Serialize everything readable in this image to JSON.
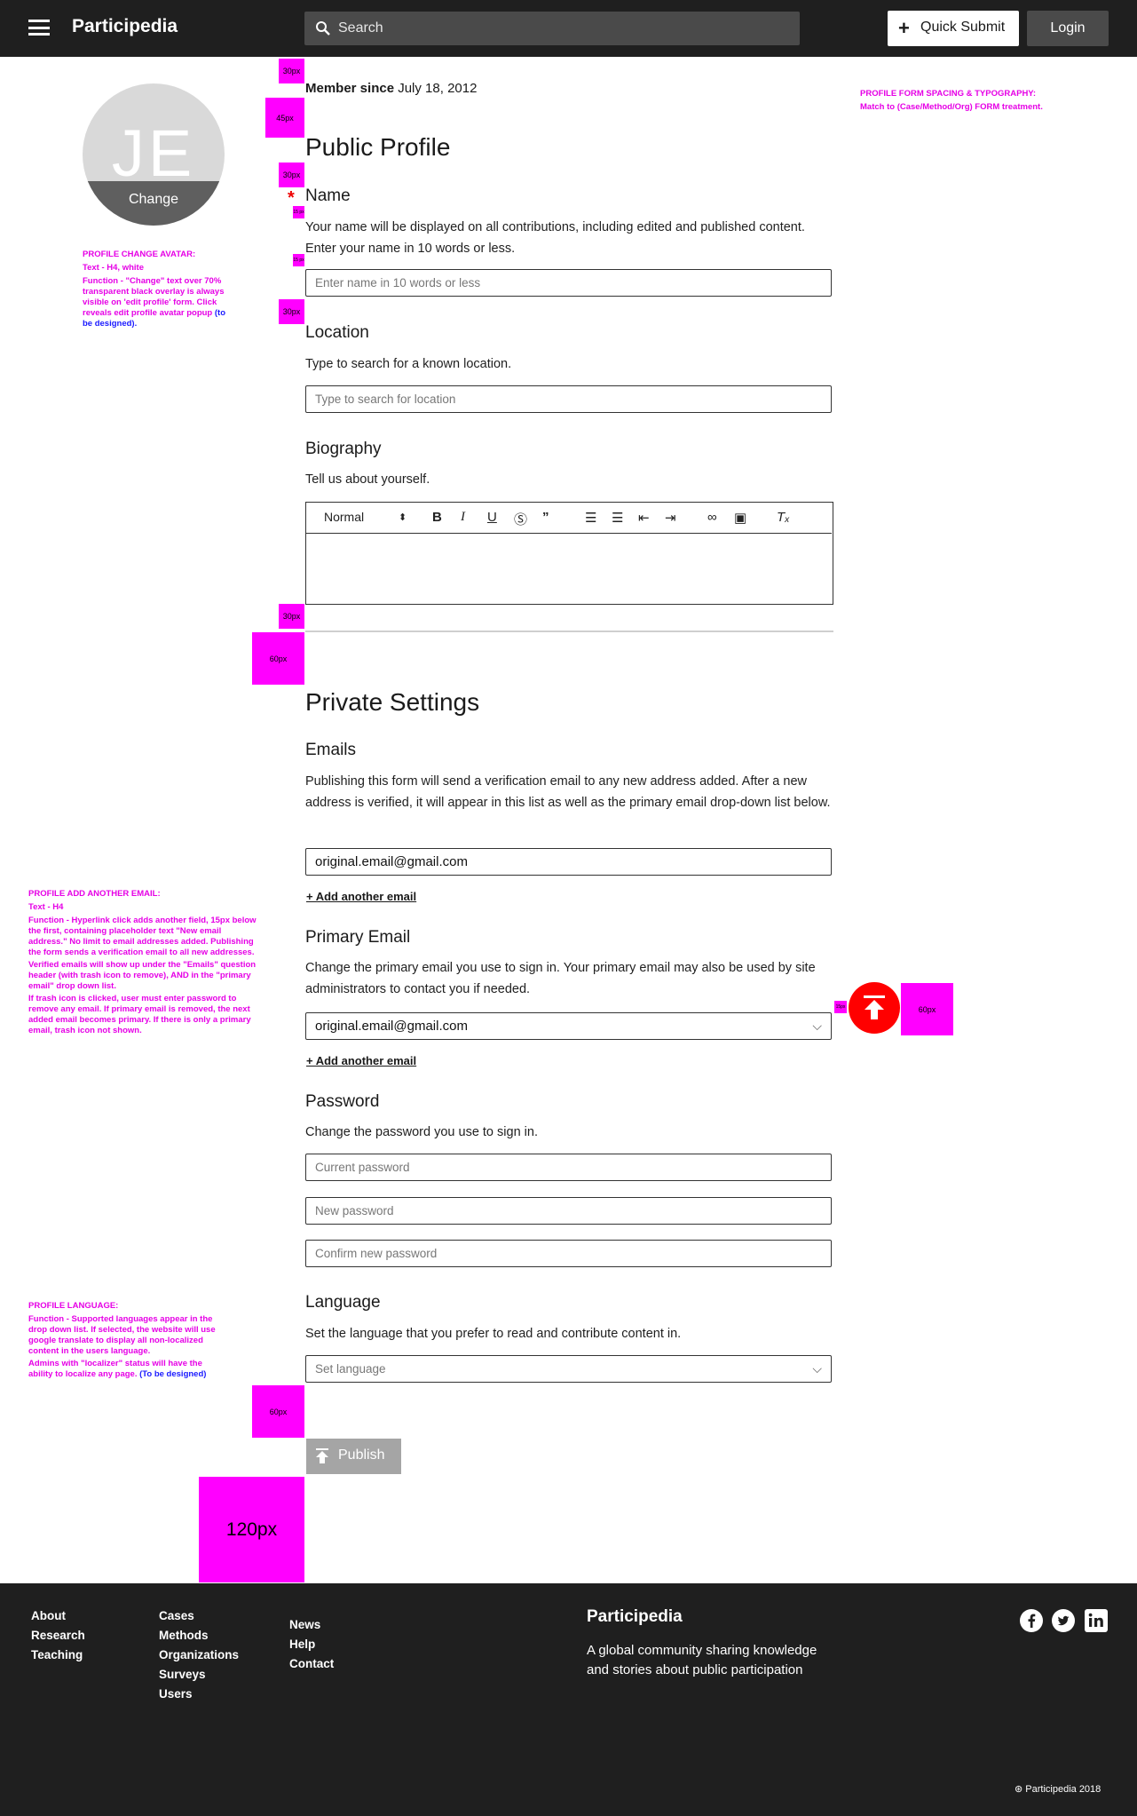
{
  "header": {
    "brand": "Participedia",
    "search_placeholder": "Search",
    "quick_submit_label": "Quick Submit",
    "login_label": "Login"
  },
  "avatar": {
    "initials": "JE",
    "change_label": "Change"
  },
  "annotations": {
    "avatar_note": {
      "title": "PROFILE CHANGE AVATAR:",
      "text": "Text - H4, white",
      "function": "Function - \"Change\" text over 70% transparent black overlay is always visible on 'edit profile' form. Click reveals edit profile avatar popup",
      "link": "(to be designed)."
    },
    "form_spacing_note": {
      "title": "PROFILE FORM SPACING & TYPOGRAPHY:",
      "text": "Match to (Case/Method/Org) FORM treatment."
    },
    "email_note": {
      "title": "PROFILE ADD ANOTHER EMAIL:",
      "text": "Text - H4",
      "function": "Function - Hyperlink click adds another field, 15px below the first, containing placeholder text \"New email address.\" No limit to email addresses added. Publishing the form sends a verification email to all new addresses.",
      "verified": "Verified emails will show up under the \"Emails\" question header (with trash icon to remove), AND in the \"primary email\" drop down list.",
      "trash": "If trash icon is clicked, user must enter password to remove any email. If primary email is removed, the next added email becomes primary. If there is only a primary email, trash icon not shown."
    },
    "language_note": {
      "title": "PROFILE LANGUAGE:",
      "function": "Function - Supported languages appear in the drop down list. If selected, the website will use google translate to display all non-localized content in the users language.",
      "admins": "Admins with \"localizer\" status will have the ability to localize any page.",
      "link": "(To be designed)"
    },
    "spacers": {
      "s30a": "30px",
      "s45": "45px",
      "s30b": "30px",
      "s30c": "30px",
      "s30d": "30px",
      "s60a": "60px",
      "s60b": "60px",
      "s60c": "60px",
      "s120": "120px",
      "s15a": "15 px",
      "s15b": "15 px",
      "s15c": "15px"
    }
  },
  "member": {
    "label": "Member since",
    "date": "July 18, 2012"
  },
  "public_profile": {
    "title": "Public Profile",
    "name_label": "Name",
    "required_mark": "*",
    "name_help_1": "Your name will be displayed on all contributions, including edited and published content.",
    "name_help_2": "Enter your name in 10 words or less.",
    "name_placeholder": "Enter name in 10 words or less",
    "location_label": "Location",
    "location_help": "Type to search for a known location.",
    "location_placeholder": "Type to search for location",
    "bio_label": "Biography",
    "bio_help": "Tell us about yourself.",
    "editor_style": "Normal"
  },
  "private_settings": {
    "title": "Private Settings",
    "emails_label": "Emails",
    "emails_help": "Publishing this form will send a verification email to any new address added. After a new address is verified, it will appear in this list as well as the primary email drop-down list below.",
    "email_value": "original.email@gmail.com",
    "add_email": "+ Add another email",
    "primary_label": "Primary Email",
    "primary_help": "Change the primary email you use to sign in. Your primary email may also be used by site administrators to contact you if needed.",
    "primary_value": "original.email@gmail.com",
    "add_email_2": "+ Add another email",
    "password_label": "Password",
    "password_help": "Change the password you use to sign in.",
    "current_pw": "Current password",
    "new_pw": "New password",
    "confirm_pw": "Confirm new password",
    "language_label": "Language",
    "language_help": "Set the language that you prefer to read and contribute content in.",
    "language_placeholder": "Set language",
    "publish_label": "Publish"
  },
  "footer": {
    "col1": [
      "About",
      "Research",
      "Teaching"
    ],
    "col2": [
      "Cases",
      "Methods",
      "Organizations",
      "Surveys",
      "Users"
    ],
    "col3": [
      "News",
      "Help",
      "Contact"
    ],
    "brand": "Participedia",
    "tagline_1": "A global community sharing knowledge",
    "tagline_2": "and stories about public participation",
    "copyright": "Participedia 2018"
  },
  "colors": {
    "header_bg": "#1f1f1f",
    "annotation": "#ff00ff",
    "fab": "#ff0000"
  }
}
